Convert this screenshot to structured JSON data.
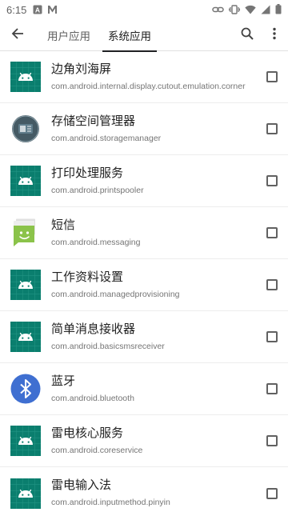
{
  "status_bar": {
    "time": "6:15",
    "left_icons": [
      "a-icon",
      "mail-m-icon"
    ],
    "right_icons": [
      "link-icon",
      "vibrate-icon",
      "wifi-icon",
      "signal-icon",
      "battery-icon"
    ]
  },
  "app_bar": {
    "back_icon": "arrow-left-icon",
    "tabs": [
      {
        "label": "用户应用",
        "selected": false
      },
      {
        "label": "系统应用",
        "selected": true
      }
    ],
    "search_icon": "search-icon",
    "more_icon": "more-vert-icon"
  },
  "apps": [
    {
      "name": "边角刘海屏",
      "package": "com.android.internal.display.cutout.emulation.corner",
      "icon": "android-robot-icon",
      "checked": false
    },
    {
      "name": "存储空间管理器",
      "package": "com.android.storagemanager",
      "icon": "storage-manager-icon",
      "checked": false
    },
    {
      "name": "打印处理服务",
      "package": "com.android.printspooler",
      "icon": "android-robot-icon",
      "checked": false
    },
    {
      "name": "短信",
      "package": "com.android.messaging",
      "icon": "messaging-icon",
      "checked": false
    },
    {
      "name": "工作资料设置",
      "package": "com.android.managedprovisioning",
      "icon": "android-robot-icon",
      "checked": false
    },
    {
      "name": "简单消息接收器",
      "package": "com.android.basicsmsreceiver",
      "icon": "android-robot-icon",
      "checked": false
    },
    {
      "name": "蓝牙",
      "package": "com.android.bluetooth",
      "icon": "bluetooth-icon",
      "checked": false
    },
    {
      "name": "雷电核心服务",
      "package": "com.android.coreservice",
      "icon": "android-robot-icon",
      "checked": false
    },
    {
      "name": "雷电输入法",
      "package": "com.android.inputmethod.pinyin",
      "icon": "android-robot-icon",
      "checked": false
    }
  ],
  "colors": {
    "android_tile": "#0a7e6e",
    "bluetooth_blue": "#3f6fd1",
    "messaging_green": "#8bc34a"
  }
}
